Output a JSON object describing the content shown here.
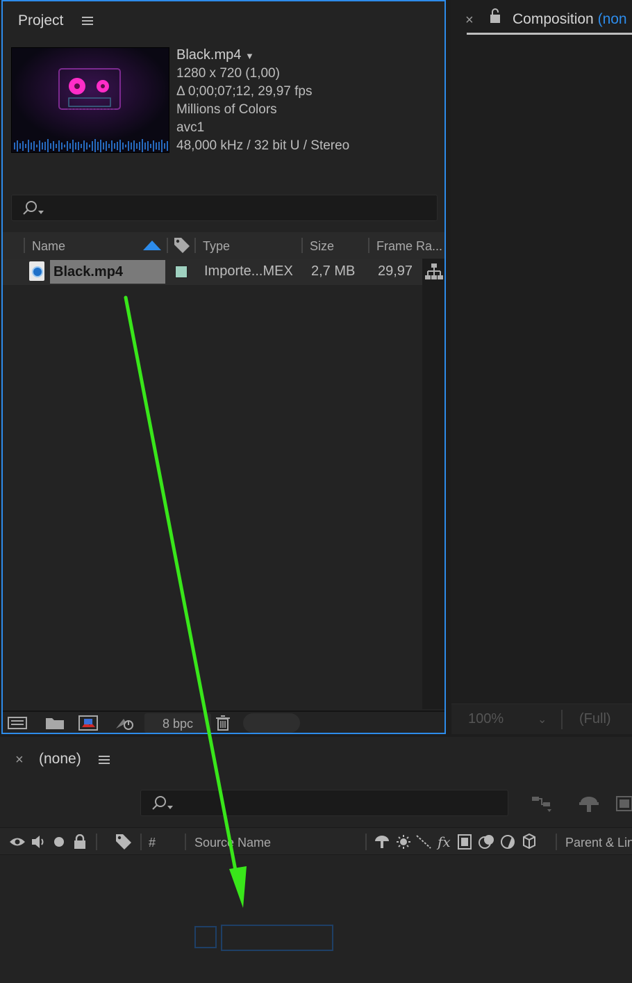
{
  "project_panel": {
    "title": "Project",
    "footprint": {
      "name": "Black.mp4",
      "dimensions": "1280 x 720 (1,00)",
      "duration": "Δ 0;00;07;12, 29,97 fps",
      "colors": "Millions of Colors",
      "codec": "avc1",
      "audio": "48,000 kHz / 32 bit U / Stereo"
    },
    "search": {
      "placeholder": ""
    },
    "columns": {
      "name": "Name",
      "type": "Type",
      "size": "Size",
      "frame_rate": "Frame Ra..."
    },
    "items": [
      {
        "name": "Black.mp4",
        "label_color": "#9fd1c0",
        "type": "Importe...MEX",
        "size": "2,7 MB",
        "frame_rate": "29,97"
      }
    ],
    "footer": {
      "bpc": "8 bpc"
    }
  },
  "composition_panel": {
    "title": "Composition",
    "comp_name": "(non",
    "zoom": "100%",
    "resolution": "(Full)"
  },
  "timeline_panel": {
    "title": "(none)",
    "columns": {
      "number": "#",
      "source_name": "Source Name",
      "parent": "Parent & Lin"
    }
  },
  "colors": {
    "accent": "#2d8ceb",
    "annotation_arrow": "#39e61a"
  },
  "icons": [
    "menu-icon",
    "search-icon",
    "lock-icon",
    "close-icon",
    "sort-ascending-icon",
    "label-tag-icon",
    "flowchart-icon",
    "trash-icon",
    "eye-icon",
    "speaker-icon",
    "solo-icon",
    "lock-icon",
    "fx-icon"
  ]
}
